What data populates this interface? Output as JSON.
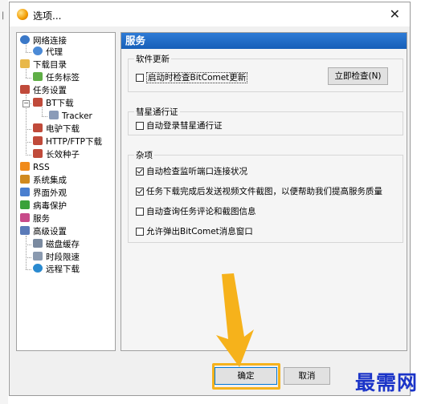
{
  "window": {
    "title": "选项..."
  },
  "tree": {
    "items": [
      {
        "label": "网络连接",
        "icon": "globe-icon",
        "color": "#3a78c8"
      },
      {
        "label": "代理",
        "icon": "globe-small-icon",
        "color": "#4b8ad6"
      },
      {
        "label": "下载目录",
        "icon": "folder-icon",
        "color": "#e8b84a"
      },
      {
        "label": "任务标签",
        "icon": "tag-icon",
        "color": "#5fae46"
      },
      {
        "label": "任务设置",
        "icon": "task-icon",
        "color": "#c04a3a"
      },
      {
        "label": "BT下载",
        "icon": "bt-icon",
        "color": "#c04a3a"
      },
      {
        "label": "Tracker",
        "icon": "tracker-icon",
        "color": "#8a9bb8"
      },
      {
        "label": "电驴下载",
        "icon": "emule-icon",
        "color": "#c04a3a"
      },
      {
        "label": "HTTP/FTP下载",
        "icon": "http-icon",
        "color": "#c04a3a"
      },
      {
        "label": "长效种子",
        "icon": "seed-icon",
        "color": "#c04a3a"
      },
      {
        "label": "RSS",
        "icon": "rss-icon",
        "color": "#f08a1a"
      },
      {
        "label": "系统集成",
        "icon": "system-icon",
        "color": "#d08a20"
      },
      {
        "label": "界面外观",
        "icon": "appearance-icon",
        "color": "#4a7fd0"
      },
      {
        "label": "病毒保护",
        "icon": "shield-icon",
        "color": "#3aa23a"
      },
      {
        "label": "服务",
        "icon": "service-icon",
        "color": "#c84a8a"
      },
      {
        "label": "高级设置",
        "icon": "advanced-icon",
        "color": "#5a7ab8"
      },
      {
        "label": "磁盘缓存",
        "icon": "disk-icon",
        "color": "#7a8aa0"
      },
      {
        "label": "时段限速",
        "icon": "clock-icon",
        "color": "#8a9ab0"
      },
      {
        "label": "远程下载",
        "icon": "remote-icon",
        "color": "#2a8ad0"
      }
    ]
  },
  "panel": {
    "header": "服务",
    "software_update": {
      "label": "软件更新",
      "check_on_start": "启动时检查BitComet更新",
      "check_now": "立即检查(N)"
    },
    "comet_pass": {
      "label": "彗星通行证",
      "auto_login": "自动登录彗星通行证"
    },
    "misc": {
      "label": "杂项",
      "items": [
        {
          "label": "自动检查监听端口连接状况",
          "checked": true
        },
        {
          "label": "任务下载完成后发送视频文件截图，以便帮助我们提高服务质量",
          "checked": true
        },
        {
          "label": "自动查询任务评论和截图信息",
          "checked": false
        },
        {
          "label": "允许弹出BitComet消息窗口",
          "checked": false
        }
      ]
    }
  },
  "buttons": {
    "ok": "确定",
    "cancel": "取消"
  },
  "watermark": "最需网",
  "colors": {
    "header": "#1e6cc8",
    "highlight": "#f6b21b",
    "arrow": "#f6b21b",
    "watermark": "#1b34c8"
  }
}
